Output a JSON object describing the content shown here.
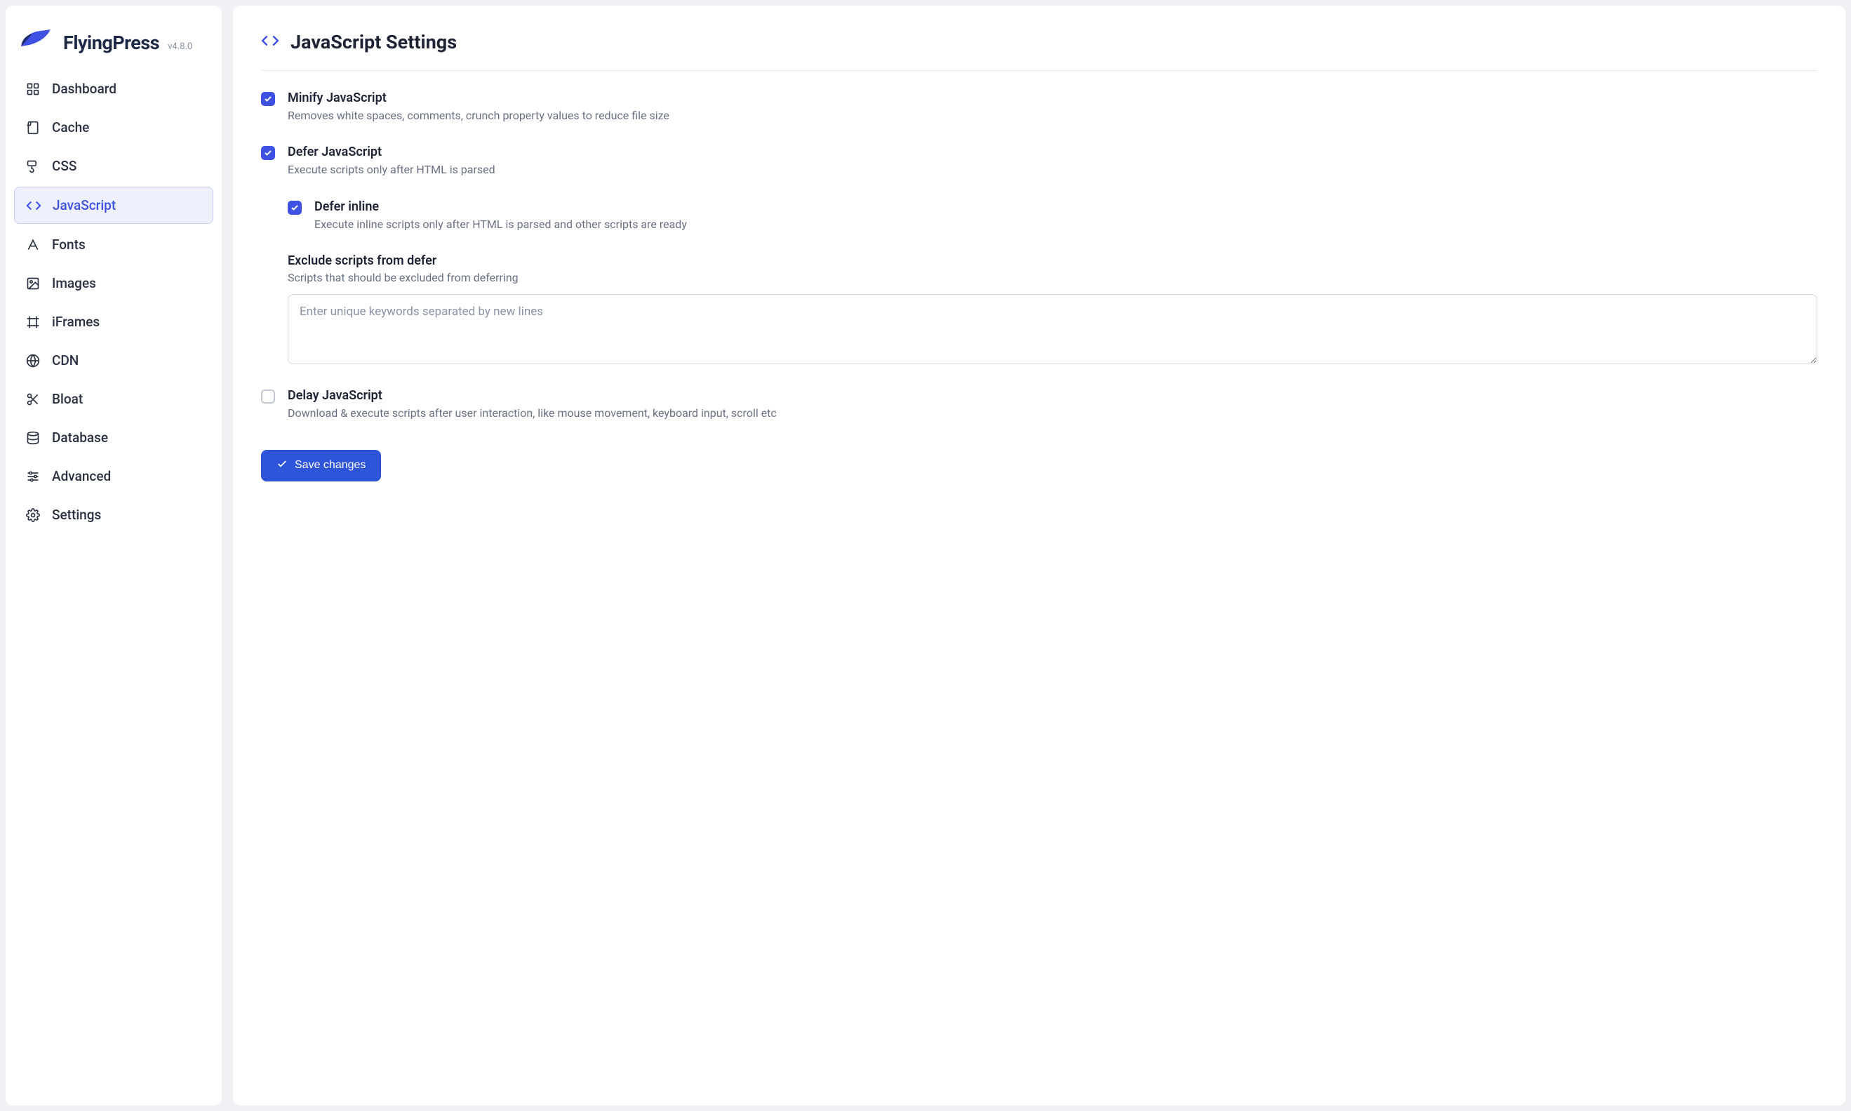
{
  "app": {
    "name": "FlyingPress",
    "version": "v4.8.0"
  },
  "sidebar": {
    "items": [
      {
        "id": "dashboard",
        "label": "Dashboard",
        "icon": "grid"
      },
      {
        "id": "cache",
        "label": "Cache",
        "icon": "file"
      },
      {
        "id": "css",
        "label": "CSS",
        "icon": "paintbrush"
      },
      {
        "id": "javascript",
        "label": "JavaScript",
        "icon": "code",
        "active": true
      },
      {
        "id": "fonts",
        "label": "Fonts",
        "icon": "font"
      },
      {
        "id": "images",
        "label": "Images",
        "icon": "image"
      },
      {
        "id": "iframes",
        "label": "iFrames",
        "icon": "frame"
      },
      {
        "id": "cdn",
        "label": "CDN",
        "icon": "globe"
      },
      {
        "id": "bloat",
        "label": "Bloat",
        "icon": "scissors"
      },
      {
        "id": "database",
        "label": "Database",
        "icon": "database"
      },
      {
        "id": "advanced",
        "label": "Advanced",
        "icon": "sliders"
      },
      {
        "id": "settings",
        "label": "Settings",
        "icon": "gear"
      }
    ]
  },
  "page": {
    "title": "JavaScript Settings",
    "settings": {
      "minify": {
        "title": "Minify JavaScript",
        "desc": "Removes white spaces, comments, crunch property values to reduce file size",
        "checked": true
      },
      "defer": {
        "title": "Defer JavaScript",
        "desc": "Execute scripts only after HTML is parsed",
        "checked": true
      },
      "defer_inline": {
        "title": "Defer inline",
        "desc": "Execute inline scripts only after HTML is parsed and other scripts are ready",
        "checked": true
      },
      "exclude": {
        "title": "Exclude scripts from defer",
        "desc": "Scripts that should be excluded from deferring",
        "placeholder": "Enter unique keywords separated by new lines"
      },
      "delay": {
        "title": "Delay JavaScript",
        "desc": "Download & execute scripts after user interaction, like mouse movement, keyboard input, scroll etc",
        "checked": false
      }
    },
    "save_label": "Save changes"
  }
}
